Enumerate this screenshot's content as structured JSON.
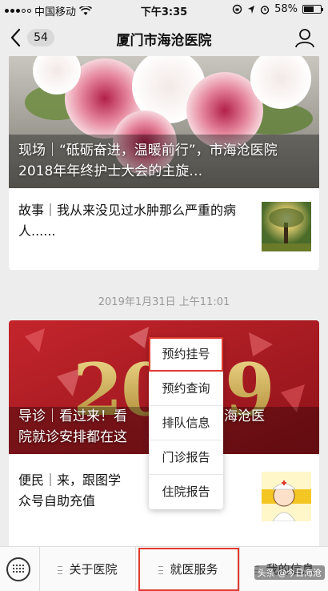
{
  "status_bar": {
    "carrier": "中国移动",
    "time": "下午3:35",
    "battery": "58%"
  },
  "nav": {
    "badge_count": "54",
    "title": "厦门市海沧医院"
  },
  "feed": {
    "card1": {
      "headline": "现场｜“砥砺奋进，温暖前行”，市海沧医院2018年年终护士大会的主旋…",
      "sub_title": "故事｜我从来没见过水肿那么严重的病人......"
    },
    "timestamp": "2019年1月31日 上午11:01",
    "card2": {
      "headline": "导诊｜看过来！看...市海沧医院就诊安排都在这...",
      "headline_left": "导诊｜看过来！看",
      "headline_right": "市海沧医",
      "headline_line2": "院就诊安排都在这",
      "sub_title_a": "便民｜来，跟图学",
      "sub_title_b": "众号自助充值"
    }
  },
  "popup_menu": {
    "items": [
      "预约挂号",
      "预约查询",
      "排队信息",
      "门诊报告",
      "住院报告"
    ]
  },
  "bottom_menu": {
    "items": [
      "关于医院",
      "就医服务",
      "我的信息"
    ]
  },
  "watermark": "头条 @今日海沧",
  "colors": {
    "highlight": "#e03a2f",
    "background": "#ededed"
  }
}
